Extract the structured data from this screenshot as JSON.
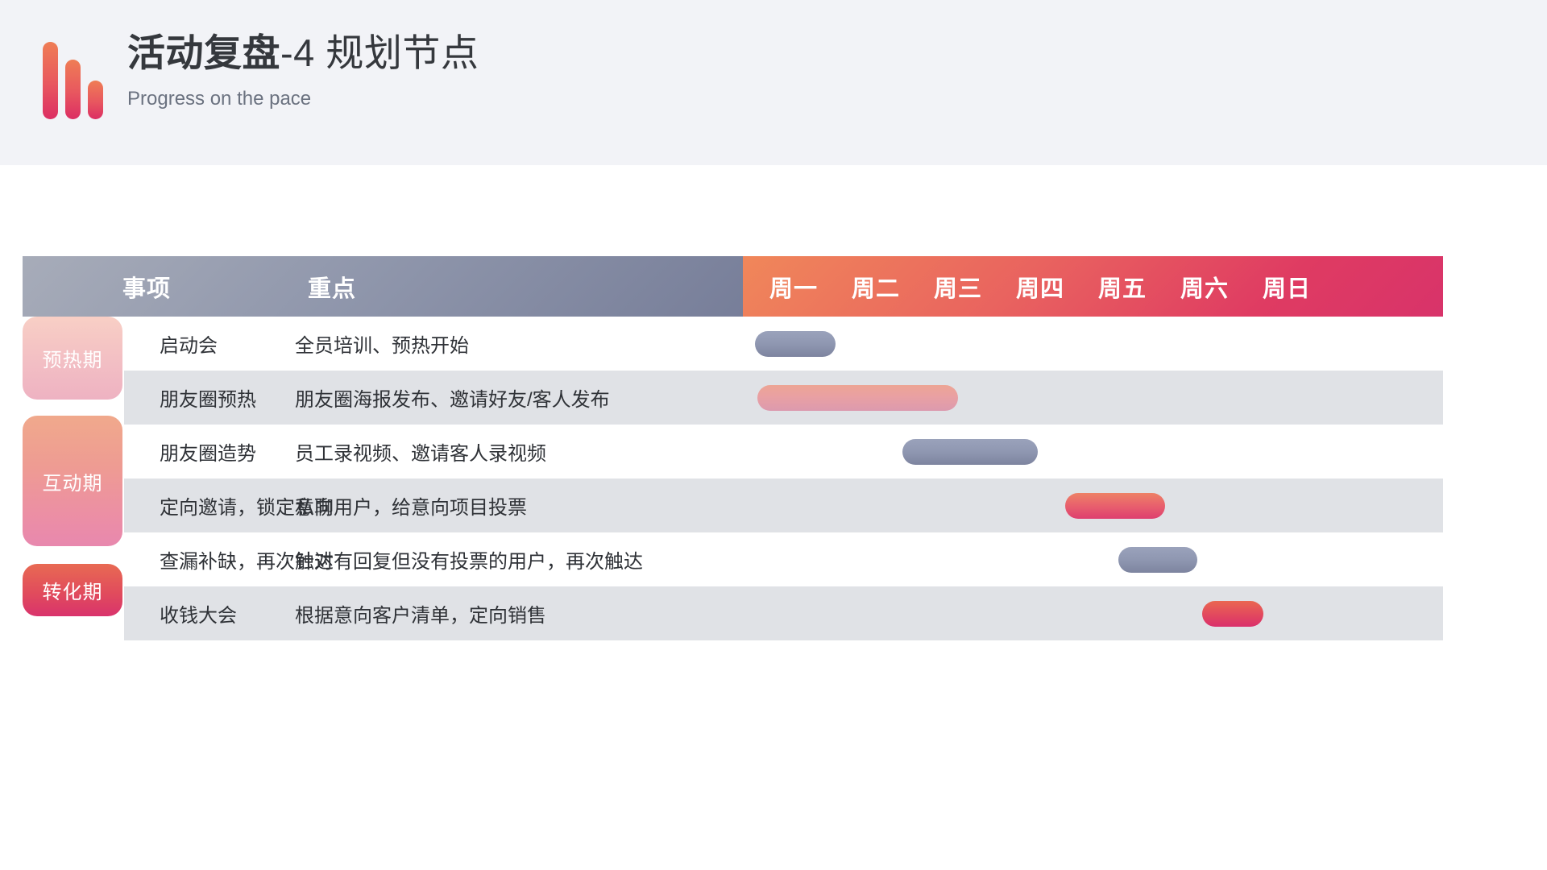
{
  "header": {
    "title_bold": "活动复盘",
    "title_regular": "-4 规划节点",
    "subtitle": "Progress on the pace",
    "logo_icon": "bar-chart-logo-icon",
    "band_color": "#f2f3f7",
    "accent_orange": "#ef7d55",
    "accent_crimson": "#dc2e63"
  },
  "table": {
    "columns": {
      "phase": "",
      "item": "事项",
      "focus": "重点"
    },
    "weekdays": [
      "周一",
      "周二",
      "周三",
      "周四",
      "周五",
      "周六",
      "周日"
    ],
    "header_left_color": "#9097ac",
    "header_right_color": "#e0555f",
    "alt_row_color": "#e0e2e6",
    "phases": [
      {
        "label": "预热期",
        "rows": 2,
        "color": "#f3c0c4"
      },
      {
        "label": "互动期",
        "rows": 3,
        "color": "#ec8fa4"
      },
      {
        "label": "转化期",
        "rows": 1,
        "color": "#e14c5c"
      }
    ],
    "rows": [
      {
        "item": "启动会",
        "focus": "全员培训、预热开始",
        "bar": {
          "start_day": 1,
          "span_days": 1,
          "color_name": "blue"
        }
      },
      {
        "item": "朋友圈预热",
        "focus": "朋友圈海报发布、邀请好友/客人发布",
        "bar": {
          "start_day": 1,
          "span_days": 2.4,
          "color_name": "pink-soft"
        }
      },
      {
        "item": "朋友圈造势",
        "focus": "员工录视频、邀请客人录视频",
        "bar": {
          "start_day": 3,
          "span_days": 1.6,
          "color_name": "blue"
        }
      },
      {
        "item": "定向邀请，锁定意向",
        "focus": "私聊用户，给意向项目投票",
        "bar": {
          "start_day": 5,
          "span_days": 1.2,
          "color_name": "pink"
        }
      },
      {
        "item": "查漏补缺，再次触达",
        "focus": "针对有回复但没有投票的用户，再次触达",
        "bar": {
          "start_day": 6,
          "span_days": 0.9,
          "color_name": "blue"
        }
      },
      {
        "item": "收钱大会",
        "focus": " 根据意向客户清单，定向销售",
        "bar": {
          "start_day": 7,
          "span_days": 0.75,
          "color_name": "red"
        }
      }
    ]
  },
  "chart_data": {
    "type": "bar",
    "title": "活动复盘-4 规划节点",
    "subtitle": "Progress on the pace",
    "xlabel": "",
    "ylabel": "",
    "categories": [
      "周一",
      "周二",
      "周三",
      "周四",
      "周五",
      "周六",
      "周日"
    ],
    "series": [
      {
        "name": "启动会",
        "phase": "预热期",
        "start": 1,
        "end": 2,
        "color": "#8f97b1"
      },
      {
        "name": "朋友圈预热",
        "phase": "预热期",
        "start": 1,
        "end": 3.4,
        "color": "#e9a0a3"
      },
      {
        "name": "朋友圈造势",
        "phase": "互动期",
        "start": 3,
        "end": 4.6,
        "color": "#8f97b1"
      },
      {
        "name": "定向邀请，锁定意向",
        "phase": "互动期",
        "start": 5,
        "end": 6.2,
        "color": "#e8606d"
      },
      {
        "name": "查漏补缺，再次触达",
        "phase": "互动期",
        "start": 6,
        "end": 6.9,
        "color": "#8f97b1"
      },
      {
        "name": "收钱大会",
        "phase": "转化期",
        "start": 7,
        "end": 7.75,
        "color": "#e34b5d"
      }
    ],
    "xlim": [
      1,
      8
    ],
    "grid": false,
    "legend": "none"
  }
}
